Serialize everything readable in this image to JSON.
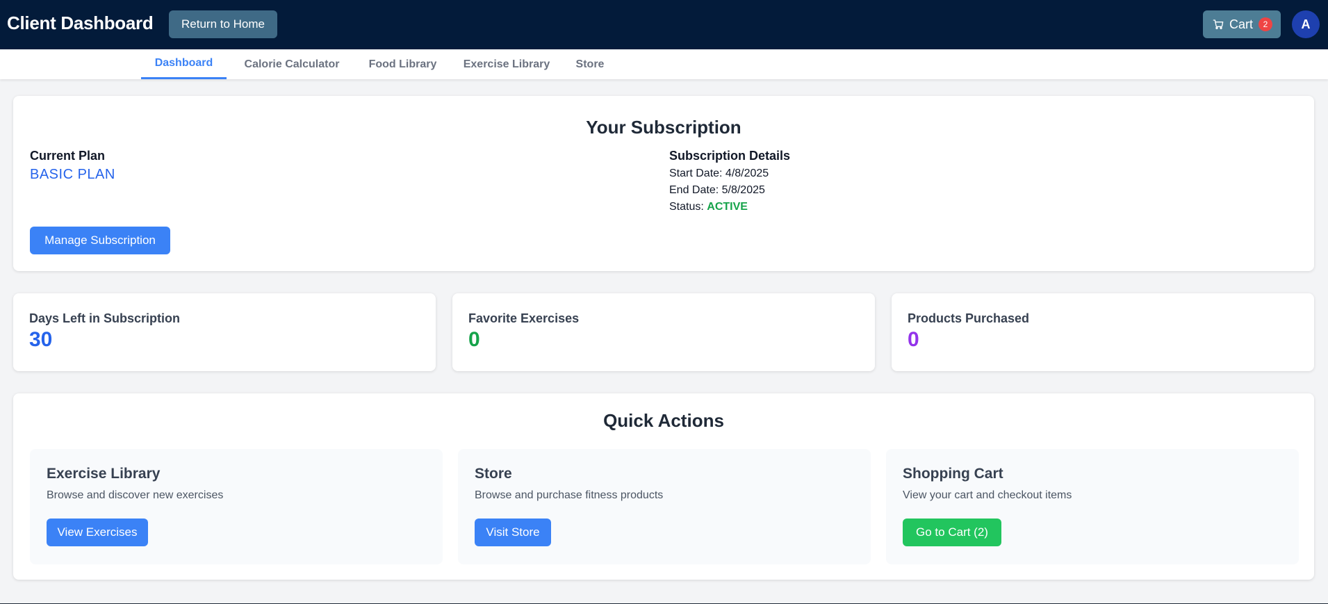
{
  "header": {
    "title": "Client Dashboard",
    "home_button": "Return to Home",
    "cart_label": "Cart",
    "cart_count": "2",
    "avatar_initial": "A"
  },
  "nav": {
    "tabs": [
      {
        "label": "Dashboard",
        "active": true
      },
      {
        "label": "Calorie Calculator",
        "active": false
      },
      {
        "label": "Food Library",
        "active": false
      },
      {
        "label": "Exercise Library",
        "active": false
      },
      {
        "label": "Store",
        "active": false
      }
    ]
  },
  "subscription": {
    "heading": "Your Subscription",
    "current_plan_label": "Current Plan",
    "plan_name": "BASIC PLAN",
    "manage_button": "Manage Subscription",
    "details_label": "Subscription Details",
    "start_date": "Start Date: 4/8/2025",
    "end_date": "End Date: 5/8/2025",
    "status_label": "Status:",
    "status_value": "ACTIVE"
  },
  "stats": [
    {
      "label": "Days Left in Subscription",
      "value": "30",
      "color": "#2563eb"
    },
    {
      "label": "Favorite Exercises",
      "value": "0",
      "color": "#16a34a"
    },
    {
      "label": "Products Purchased",
      "value": "0",
      "color": "#9333ea"
    }
  ],
  "quick_actions": {
    "heading": "Quick Actions",
    "items": [
      {
        "title": "Exercise Library",
        "description": "Browse and discover new exercises",
        "button": "View Exercises"
      },
      {
        "title": "Store",
        "description": "Browse and purchase fitness products",
        "button": "Visit Store"
      },
      {
        "title": "Shopping Cart",
        "description": "View your cart and checkout items",
        "button": "Go to Cart (2)"
      }
    ]
  },
  "icons": {
    "cart": "cart-icon"
  },
  "colors": {
    "header_bg": "#031b3a",
    "accent": "#3b82f6",
    "success": "#22c55e"
  }
}
